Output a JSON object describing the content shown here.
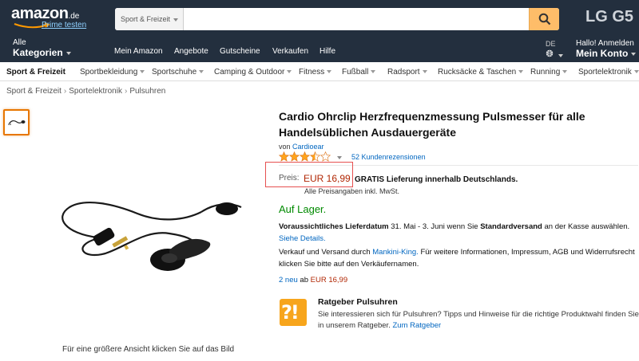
{
  "header": {
    "logo_text": "amazon",
    "logo_tld": ".de",
    "prime_link": "Prime testen",
    "search": {
      "category": "Sport & Freizeit",
      "value": "",
      "placeholder": ""
    },
    "ad_text": "LG G5",
    "all_categories_line1": "Alle",
    "all_categories_line2": "Kategorien",
    "nav_links": [
      "Mein Amazon",
      "Angebote",
      "Gutscheine",
      "Verkaufen",
      "Hilfe"
    ],
    "language": "DE",
    "account_line1": "Hallo! Anmelden",
    "account_line2": "Mein Konto"
  },
  "subnav": {
    "items": [
      "Sport & Freizeit",
      "Sportbekleidung",
      "Sportschuhe",
      "Camping & Outdoor",
      "Fitness",
      "Fußball",
      "Radsport",
      "Rucksäcke & Taschen",
      "Running",
      "Sportelektronik"
    ]
  },
  "breadcrumb": [
    "Sport & Freizeit",
    "Sportelektronik",
    "Pulsuhren"
  ],
  "product": {
    "title": "Cardio Ohrclip Herzfrequenzmessung Pulsmesser für alle Handelsüblichen Ausdauergeräte",
    "by_prefix": "von",
    "brand": "Cardioear",
    "rating_stars": 3.5,
    "reviews": "52 Kundenrezensionen",
    "price_label": "Preis:",
    "price": "EUR 16,99",
    "free_shipping": "GRATIS Lieferung innerhalb Deutschlands.",
    "vat_note": "Alle Preisangaben inkl. MwSt.",
    "stock": "Auf Lager.",
    "delivery_bold_1": "Voraussichtliches Lieferdatum",
    "delivery_text_1": "31. Mai - 3. Juni wenn Sie",
    "delivery_bold_2": "Standardversand",
    "delivery_text_2": "an der Kasse auswählen.",
    "delivery_link": "Siehe Details.",
    "seller_prefix": "Verkauf und Versand durch",
    "seller_name": "Mankini-King.",
    "seller_text": "Für weitere Informationen, Impressum, AGB und Widerrufsrecht klicken Sie bitte auf den Verkäufernamen.",
    "new_offers_link": "2 neu",
    "new_offers_mid": "ab",
    "new_offers_price": "EUR 16,99",
    "image_caption": "Für eine größere Ansicht klicken Sie auf das Bild"
  },
  "guide": {
    "icon_text": "?!",
    "title": "Ratgeber Pulsuhren",
    "text": "Sie interessieren sich für Pulsuhren? Tipps und Hinweise für die richtige Produktwahl finden Sie in unserem Ratgeber.",
    "link": "Zum Ratgeber"
  },
  "colors": {
    "header_bg": "#232f3e",
    "search_button": "#febd69",
    "price": "#b12704",
    "stock": "#008a00",
    "link": "#0066c0",
    "star": "#ffa41c",
    "price_highlight_box": "#e65050"
  }
}
